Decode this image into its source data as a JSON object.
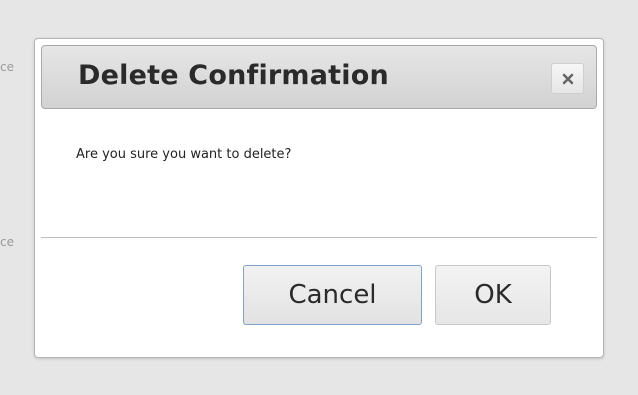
{
  "background": {
    "fragment_1": "ce",
    "fragment_2": "ce"
  },
  "dialog": {
    "title": "Delete Confirmation",
    "close_icon": "close-icon",
    "message": "Are you sure you want to delete?",
    "buttons": {
      "cancel_label": "Cancel",
      "ok_label": "OK"
    }
  },
  "colors": {
    "backdrop": "#e6e6e6",
    "titlebar": "#d9d9d9",
    "cancel_focus_border": "#7da2ce"
  }
}
